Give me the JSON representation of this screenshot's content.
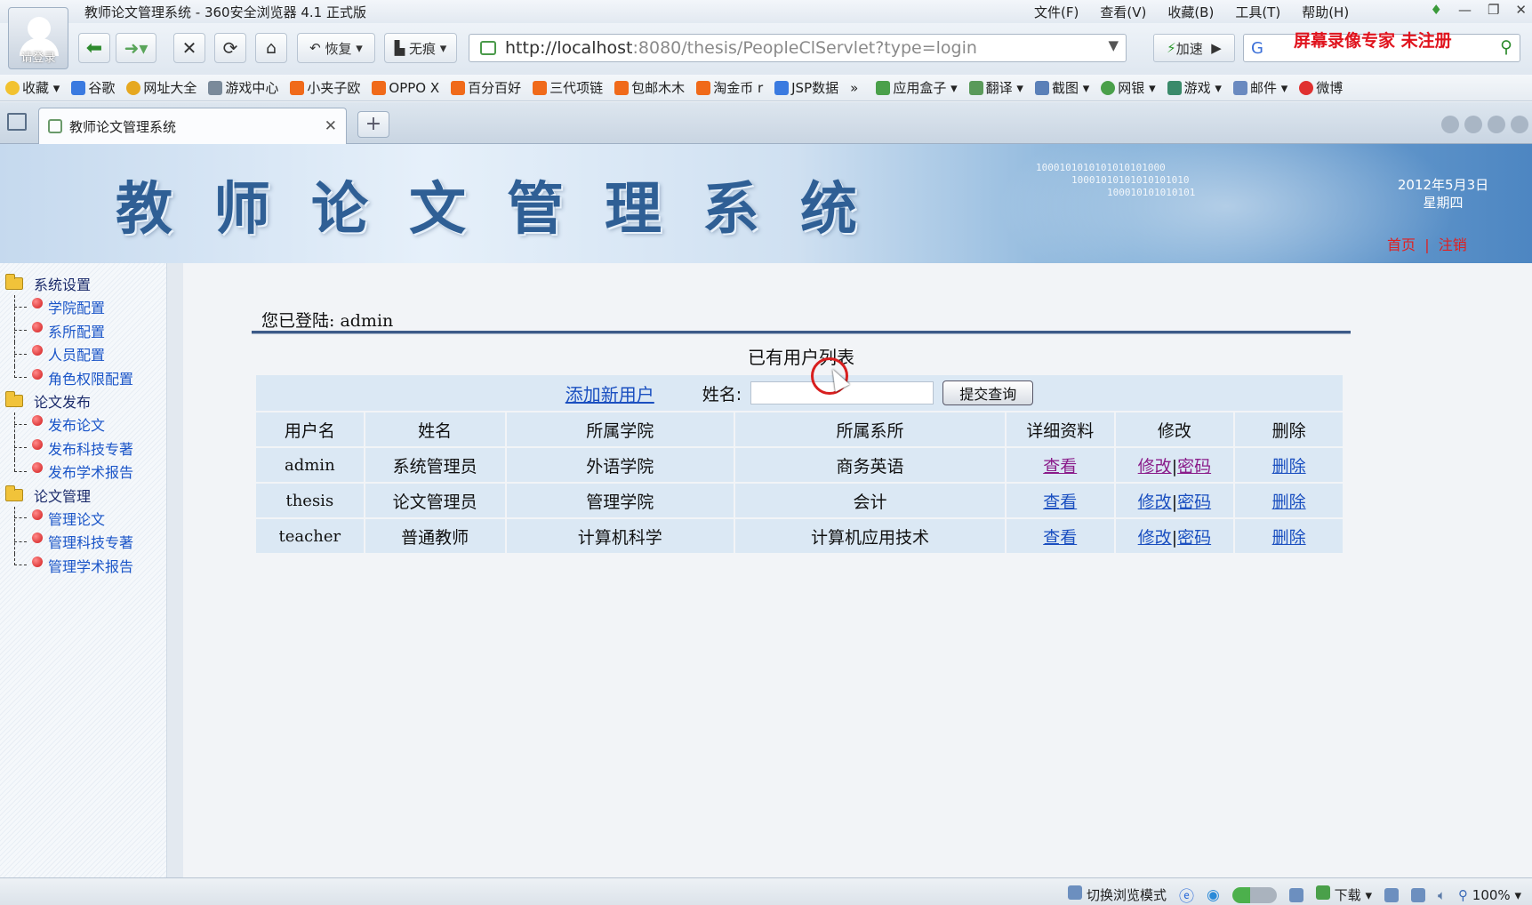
{
  "browser": {
    "window_title": "教师论文管理系统 - 360安全浏览器 4.1 正式版",
    "login_label": "请登录",
    "menu": [
      "文件(F)",
      "查看(V)",
      "收藏(B)",
      "工具(T)",
      "帮助(H)"
    ],
    "restore_label": "恢复",
    "notrace_label": "无痕",
    "address_host": "http://localhost",
    "address_rest": ":8080/thesis/PeopleClServlet?type=login",
    "speedup_label": "加速",
    "recorder_watermark": "屏幕录像专家  未注册",
    "bookmarks": [
      "收藏",
      "谷歌",
      "网址大全",
      "游戏中心",
      "小夹子欧",
      "OPPO X",
      "百分百好",
      "三代项链",
      "包邮木木",
      "淘金币 r",
      "JSP数据",
      "应用盒子",
      "翻译",
      "截图",
      "网银",
      "游戏",
      "邮件",
      "微博"
    ],
    "tab_title": "教师论文管理系统",
    "status_mode": "切换浏览模式",
    "status_download": "下载",
    "status_zoom": "100%"
  },
  "banner": {
    "title": "教师论文管理系统",
    "binary": [
      "1000101010101010101000",
      "10001010101010101010",
      "100010101010101"
    ],
    "date": "2012年5月3日",
    "weekday": "星期四",
    "home": "首页",
    "sep": "|",
    "logout": "注销"
  },
  "sidebar": {
    "categories": [
      {
        "label": "系统设置",
        "items": [
          "学院配置",
          "系所配置",
          "人员配置",
          "角色权限配置"
        ]
      },
      {
        "label": "论文发布",
        "items": [
          "发布论文",
          "发布科技专著",
          "发布学术报告"
        ]
      },
      {
        "label": "论文管理",
        "items": [
          "管理论文",
          "管理科技专著",
          "管理学术报告"
        ]
      }
    ]
  },
  "main": {
    "logged_in": "您已登陆: admin",
    "list_title": "已有用户列表",
    "add_user": "添加新用户",
    "name_label": "姓名:",
    "name_value": "",
    "submit": "提交查询",
    "headers": [
      "用户名",
      "姓名",
      "所属学院",
      "所属系所",
      "详细资料",
      "修改",
      "删除"
    ],
    "rows": [
      {
        "username": "admin",
        "name": "系统管理员",
        "college": "外语学院",
        "dept": "商务英语",
        "view": "查看",
        "edit": "修改",
        "pwd": "密码",
        "del": "删除"
      },
      {
        "username": "thesis",
        "name": "论文管理员",
        "college": "管理学院",
        "dept": "会计",
        "view": "查看",
        "edit": "修改",
        "pwd": "密码",
        "del": "删除"
      },
      {
        "username": "teacher",
        "name": "普通教师",
        "college": "计算机科学",
        "dept": "计算机应用技术",
        "view": "查看",
        "edit": "修改",
        "pwd": "密码",
        "del": "删除"
      }
    ]
  }
}
